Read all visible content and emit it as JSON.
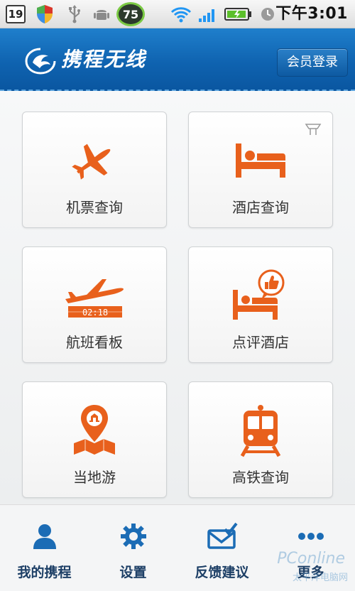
{
  "status_bar": {
    "date_badge": "19",
    "battery_percent": "75",
    "time": "下午3:01",
    "icons": [
      "calendar-icon",
      "shield-icon",
      "usb-icon",
      "android-icon",
      "battery-percent-icon",
      "wifi-icon",
      "signal-icon",
      "battery-icon",
      "clock-icon"
    ]
  },
  "header": {
    "app_name": "携程无线",
    "login_label": "会员登录"
  },
  "tiles": [
    {
      "label": "机票查询",
      "icon": "airplane-icon"
    },
    {
      "label": "酒店查询",
      "icon": "bed-icon"
    },
    {
      "label": "航班看板",
      "icon": "flight-board-icon",
      "board_text": "02:18"
    },
    {
      "label": "点评酒店",
      "icon": "hotel-review-icon"
    },
    {
      "label": "当地游",
      "icon": "map-pin-icon"
    },
    {
      "label": "高铁查询",
      "icon": "train-icon"
    }
  ],
  "bottom_nav": [
    {
      "label": "我的携程",
      "icon": "user-icon"
    },
    {
      "label": "设置",
      "icon": "gear-icon"
    },
    {
      "label": "反馈建议",
      "icon": "mail-icon"
    },
    {
      "label": "更多",
      "icon": "more-icon"
    }
  ],
  "watermark": {
    "line1": "PConline",
    "line2": "太平洋电脑网"
  },
  "colors": {
    "accent": "#e8601c",
    "header_blue": "#0f63b0",
    "nav_text": "#1d3f66"
  }
}
